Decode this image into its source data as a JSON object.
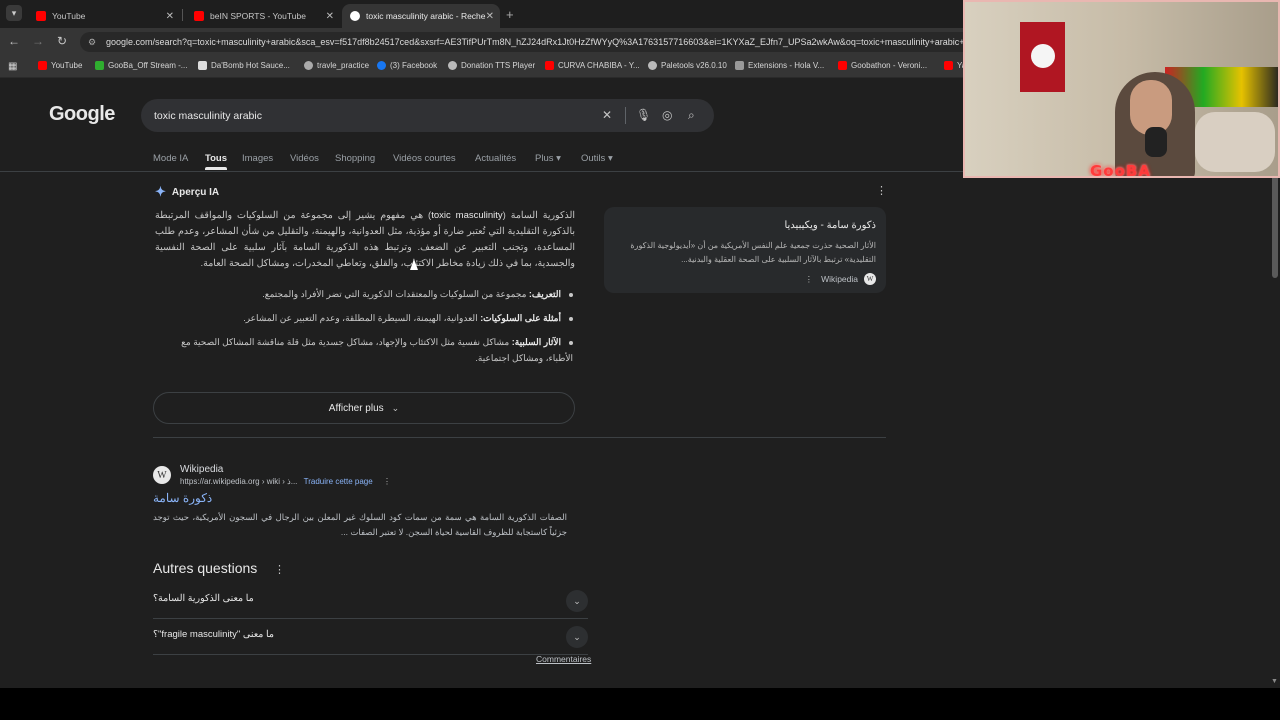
{
  "browser": {
    "tabs": [
      {
        "title": "YouTube",
        "icon": "youtube-icon"
      },
      {
        "title": "beIN SPORTS - YouTube",
        "icon": "youtube-icon"
      },
      {
        "title": "toxic masculinity arabic - Reche",
        "icon": "google-icon"
      }
    ],
    "url": "google.com/search?q=toxic+masculinity+arabic&sca_esv=f517df8b24517ced&sxsrf=AE3TifPUrTm8N_hZJ24dRx1Jt0HzZfWYyQ%3A1763157716603&ei=1KYXaZ_EJfn7_UPSa2wkAw&oq=toxic+masculinity+arabic+en+",
    "bookmarks": [
      "YouTube",
      "GooBa_Off Stream -...",
      "Da'Bomb Hot Sauce...",
      "travle_practice",
      "(3) Facebook",
      "Donation TTS Player",
      "CURVA CHABIBA - Y...",
      "Paletools v26.0.10",
      "Extensions - Hola V...",
      "Goobathon - Veroni...",
      "Ya"
    ]
  },
  "google": {
    "logo": "Google",
    "query": "toxic masculinity arabic",
    "tabs": [
      "Mode IA",
      "Tous",
      "Images",
      "Vidéos",
      "Shopping",
      "Vidéos courtes",
      "Actualités",
      "Plus",
      "Outils"
    ],
    "ai_overview": {
      "title": "Aperçu IA",
      "paragraph_pre": "الذكورية السامة (",
      "paragraph_term": "toxic masculinity",
      "paragraph_post": ") هي مفهوم يشير إلى مجموعة من السلوكيات والمواقف المرتبطة بالذكورة التقليدية التي تُعتبر ضارة أو مؤذية، مثل العدوانية، والهيمنة، والتقليل من شأن المشاعر، وعدم طلب المساعدة، وتجنب التعبير عن الضعف. وترتبط هذه الذكورية السامة بآثار سلبية على الصحة النفسية والجسدية، بما في ذلك زيادة مخاطر الاكتئاب، والقلق، وتعاطي المخدرات، ومشاكل الصحة العامة.",
      "bullets": [
        {
          "label": "التعريف:",
          "text": " مجموعة من السلوكيات والمعتقدات الذكورية التي تضر الأفراد والمجتمع."
        },
        {
          "label": "أمثلة على السلوكيات:",
          "text": " العدوانية، الهيمنة، السيطرة المطلقة، وعدم التعبير عن المشاعر."
        },
        {
          "label": "الآثار السلبية:",
          "text": " مشاكل نفسية مثل الاكتئاب والإجهاد، مشاكل جسدية مثل قلة مناقشة المشاكل الصحية مع الأطباء، ومشاكل اجتماعية."
        }
      ],
      "show_more": "Afficher plus",
      "card": {
        "title": "ذكورة سامة - ويكيبيديا",
        "desc": "الأثار الصحية حذرت جمعية علم النفس الأمريكية من أن «أيديولوجية الذكورة التقليدية» ترتبط بالآثار السلبية على الصحة العقلية والبدنية...",
        "source": "Wikipedia"
      }
    },
    "result": {
      "site": "Wikipedia",
      "url": "https://ar.wikipedia.org › wiki › ذ...",
      "translate": "Traduire cette page",
      "title": "ذكورة سامة",
      "snippet": "الصفات الذكورية السامة هي سمة من سمات كود السلوك غير المعلن بين الرجال في السجون الأمريكية، حيث توجد جزئياً كاستجابة للظروف القاسية لحياة السجن. لا تعتبر الصفات ..."
    },
    "paa": {
      "title": "Autres questions",
      "questions": [
        "ما معنى الذكورية السامة؟",
        "ما معنى \"fragile masculinity\"؟"
      ],
      "feedback": "Commentaires"
    }
  },
  "webcam": {
    "name": "GooBA"
  },
  "colors": {
    "link": "#8ab4f8",
    "background": "#1f1f1f",
    "youtube": "#ff0000"
  }
}
